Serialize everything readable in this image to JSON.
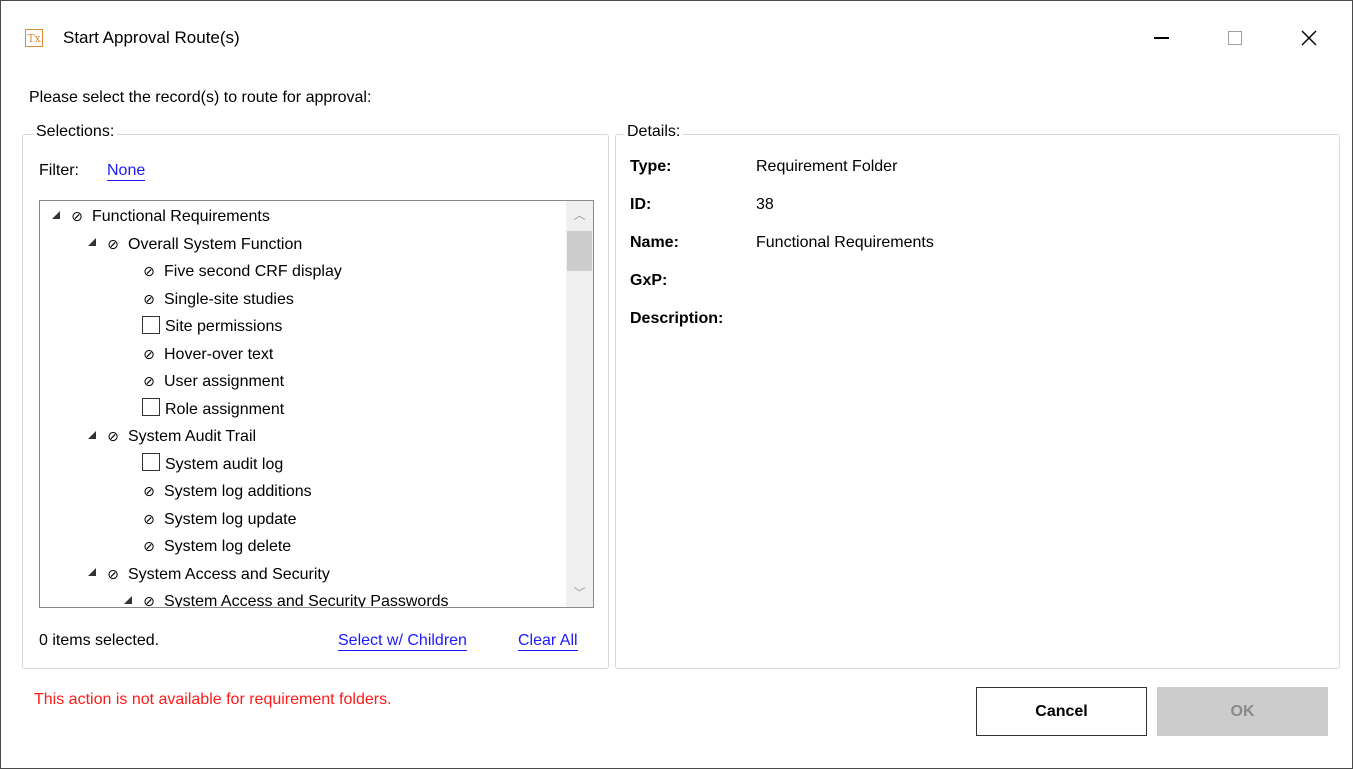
{
  "window": {
    "title": "Start Approval Route(s)",
    "app_icon_text": "Tx",
    "icons": {
      "minimize": "minimize-icon",
      "maximize": "maximize-icon",
      "close": "close-icon"
    },
    "close_glyph": "✕"
  },
  "prompt": "Please select the record(s) to route for approval:",
  "selections": {
    "legend": "Selections:",
    "filter_label": "Filter:",
    "filter_value": "None",
    "tree": [
      {
        "label": "Functional Requirements",
        "level": 0,
        "expander": true,
        "state": "none"
      },
      {
        "label": "Overall System Function",
        "level": 1,
        "expander": true,
        "state": "none"
      },
      {
        "label": "Five second CRF display",
        "level": 2,
        "expander": false,
        "state": "none"
      },
      {
        "label": "Single-site studies",
        "level": 2,
        "expander": false,
        "state": "none"
      },
      {
        "label": "Site permissions",
        "level": 2,
        "expander": false,
        "state": "checkbox"
      },
      {
        "label": "Hover-over text",
        "level": 2,
        "expander": false,
        "state": "none"
      },
      {
        "label": "User assignment",
        "level": 2,
        "expander": false,
        "state": "none"
      },
      {
        "label": "Role assignment",
        "level": 2,
        "expander": false,
        "state": "checkbox"
      },
      {
        "label": "System Audit Trail",
        "level": 1,
        "expander": true,
        "state": "none"
      },
      {
        "label": "System audit log",
        "level": 2,
        "expander": false,
        "state": "checkbox"
      },
      {
        "label": "System log additions",
        "level": 2,
        "expander": false,
        "state": "none"
      },
      {
        "label": "System log update",
        "level": 2,
        "expander": false,
        "state": "none"
      },
      {
        "label": "System log delete",
        "level": 2,
        "expander": false,
        "state": "none"
      },
      {
        "label": "System Access and Security",
        "level": 1,
        "expander": true,
        "state": "none"
      },
      {
        "label": "System Access and Security Passwords",
        "level": 2,
        "expander": true,
        "state": "none"
      }
    ],
    "no_select_symbol": "⊘",
    "status": "0 items selected.",
    "select_children": "Select w/ Children",
    "clear_all": "Clear All"
  },
  "details": {
    "legend": "Details:",
    "fields": [
      {
        "label": "Type:",
        "value": "Requirement Folder"
      },
      {
        "label": "ID:",
        "value": "38"
      },
      {
        "label": "Name:",
        "value": "Functional Requirements"
      },
      {
        "label": "GxP:",
        "value": ""
      },
      {
        "label": "Description:",
        "value": ""
      }
    ]
  },
  "error": "This action is not available for requirement folders.",
  "buttons": {
    "cancel": "Cancel",
    "ok": "OK"
  },
  "colors": {
    "link": "#1a1aff",
    "error": "#ff1a1a",
    "ok_disabled_bg": "#cccccc"
  }
}
